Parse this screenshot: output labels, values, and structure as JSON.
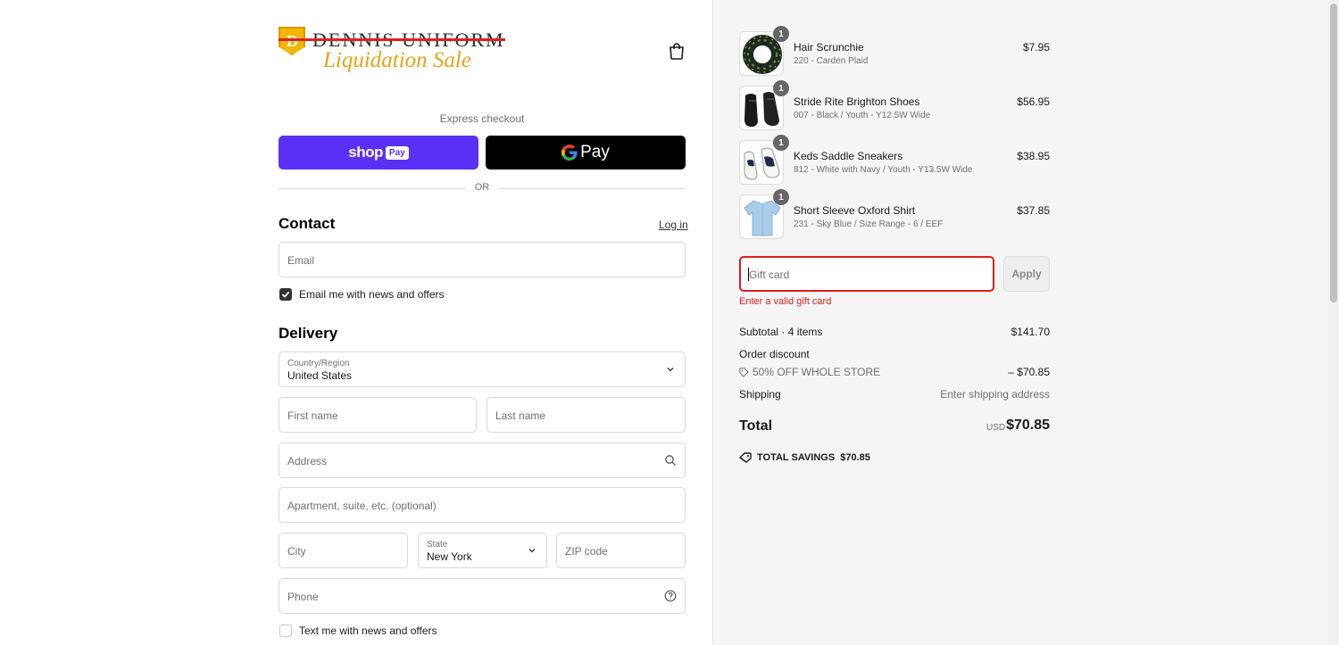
{
  "brand": {
    "logo_letter": "D",
    "logo_word": "DENNIS UNIFORM",
    "logo_sale": "Liquidation Sale"
  },
  "express": {
    "label": "Express checkout",
    "shop_text": "shop",
    "shop_pay_pill": "Pay",
    "gpay_text": "Pay",
    "or_text": "OR"
  },
  "contact": {
    "title": "Contact",
    "login_label": "Log in",
    "email_placeholder": "Email",
    "email_opt_in_label": "Email me with news and offers",
    "email_opt_in_checked": true
  },
  "delivery": {
    "title": "Delivery",
    "country_label": "Country/Region",
    "country_value": "United States",
    "first_name_placeholder": "First name",
    "last_name_placeholder": "Last name",
    "address_placeholder": "Address",
    "apartment_placeholder": "Apartment, suite, etc. (optional)",
    "city_placeholder": "City",
    "state_label": "State",
    "state_value": "New York",
    "zip_placeholder": "ZIP code",
    "phone_placeholder": "Phone",
    "sms_opt_in_label": "Text me with news and offers",
    "sms_opt_in_checked": false
  },
  "cart": {
    "items": [
      {
        "name": "Hair Scrunchie",
        "variant": "220 - Carden Plaid",
        "price": "$7.95",
        "qty": "1"
      },
      {
        "name": "Stride Rite Brighton Shoes",
        "variant": "007 - Black / Youth - Y12.5W Wide",
        "price": "$56.95",
        "qty": "1"
      },
      {
        "name": "Keds Saddle Sneakers",
        "variant": "812 - White with Navy / Youth - Y13.5W Wide",
        "price": "$38.95",
        "qty": "1"
      },
      {
        "name": "Short Sleeve Oxford Shirt",
        "variant": "231 - Sky Blue / Size Range - 6 / EEF",
        "price": "$37.85",
        "qty": "1"
      }
    ],
    "gift_card_placeholder": "Gift card",
    "apply_label": "Apply",
    "gift_error": "Enter a valid gift card"
  },
  "summary": {
    "subtotal_label": "Subtotal · 4 items",
    "subtotal_value": "$141.70",
    "discount_label": "Order discount",
    "discount_code": "50% OFF WHOLE STORE",
    "discount_value": "– $70.85",
    "shipping_label": "Shipping",
    "shipping_value": "Enter shipping address",
    "total_label": "Total",
    "total_currency": "USD",
    "total_value": "$70.85",
    "savings_label": "TOTAL SAVINGS",
    "savings_value": "$70.85"
  },
  "colors": {
    "shop_pay": "#5a31f4",
    "error": "#dd1d1d",
    "logo_gold": "#e8a317"
  }
}
